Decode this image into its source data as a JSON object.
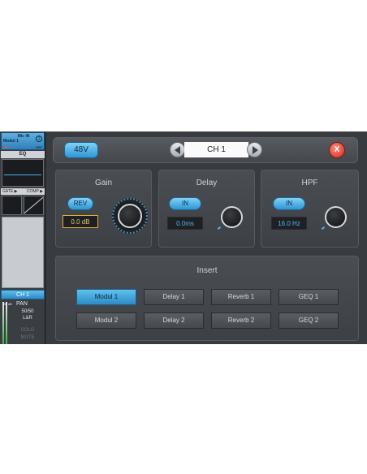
{
  "strip": {
    "source": "Mic IN",
    "module": "Modul 1",
    "badge_number": "1",
    "tag_left": "48V",
    "tag_right": "HPF",
    "eq_label": "EQ",
    "gate_label": "GATE ▶",
    "comp_label": "COMP ▶",
    "channel": "CH 1",
    "db_label": "-80 dB",
    "pan_label": "PAN",
    "pan_value": "50/50",
    "bus": "L&R",
    "solo": "SOLO",
    "mute": "MUTE"
  },
  "header": {
    "phantom_label": "48V",
    "channel_title": "CH 1",
    "close_label": "X"
  },
  "gain": {
    "title": "Gain",
    "rev_label": "REV",
    "value": "0.0 dB"
  },
  "delay": {
    "title": "Delay",
    "in_label": "IN",
    "value": "0.0ms"
  },
  "hpf": {
    "title": "HPF",
    "in_label": "IN",
    "value": "16.0 Hz"
  },
  "insert": {
    "title": "Insert",
    "row1": [
      "Modul 1",
      "Delay 1",
      "Reverb 1",
      "GEQ 1"
    ],
    "row2": [
      "Modul 2",
      "Delay 2",
      "Reverb 2",
      "GEQ 2"
    ],
    "active": "Modul 1"
  },
  "colors": {
    "accent": "#2f96d3",
    "close": "#d0281c",
    "gain_value": "#d9b23a"
  }
}
